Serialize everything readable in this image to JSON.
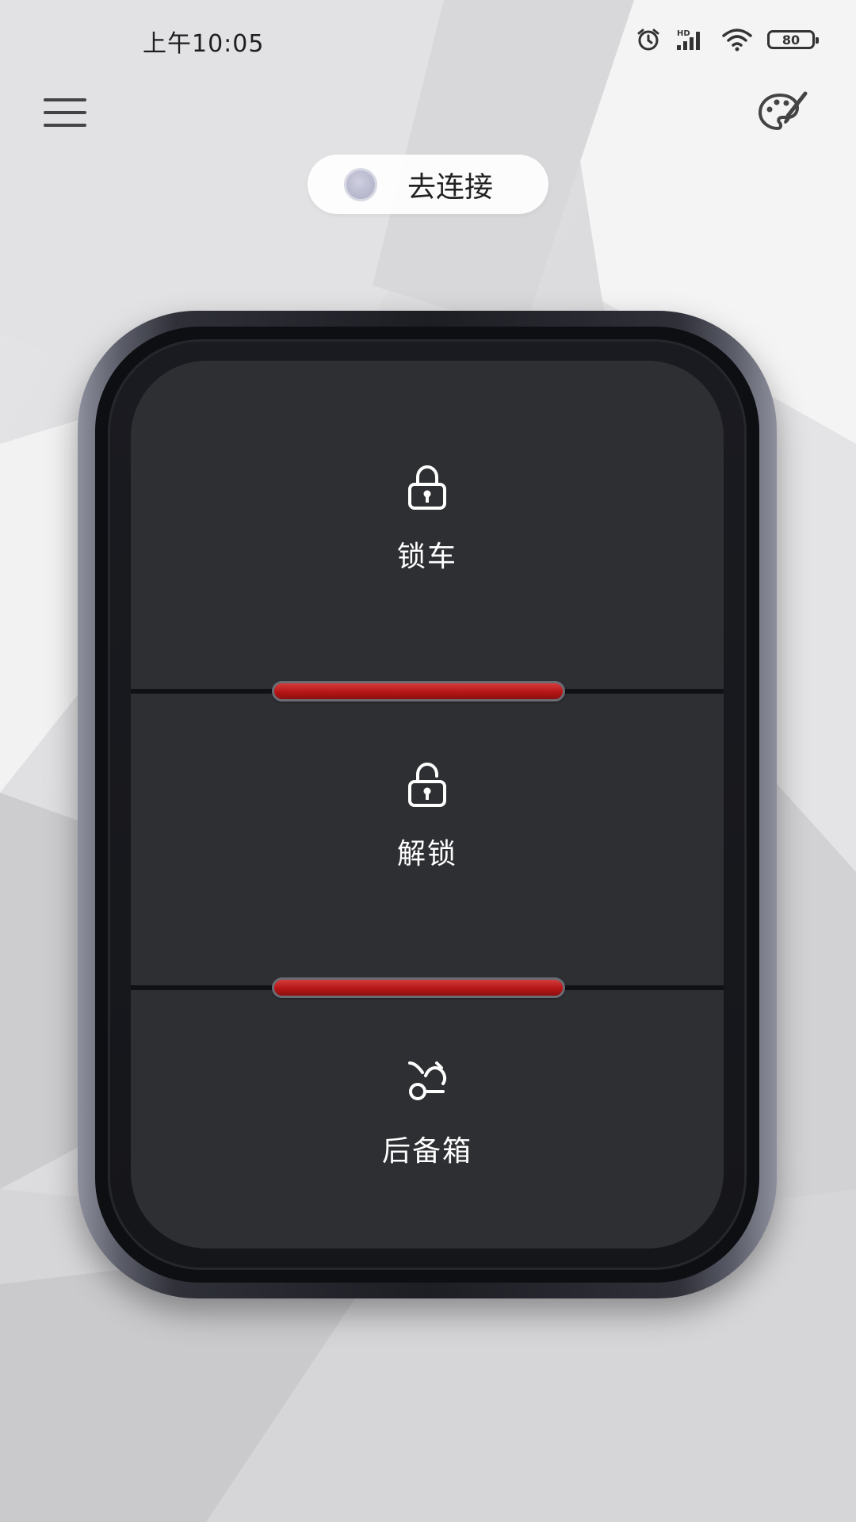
{
  "status_bar": {
    "time": "上午10:05",
    "battery": "80",
    "icons": [
      "alarm-icon",
      "hd-signal-icon",
      "wifi-icon",
      "battery-icon"
    ]
  },
  "header": {
    "menu_icon": "menu-icon",
    "theme_icon": "palette-icon"
  },
  "connect": {
    "label": "去连接",
    "state_color": "#b6b6cc"
  },
  "fob": {
    "buttons": [
      {
        "label": "锁车",
        "icon": "lock-icon"
      },
      {
        "label": "解锁",
        "icon": "unlock-icon"
      },
      {
        "label": "后备箱",
        "icon": "trunk-icon"
      }
    ],
    "accent_color": "#b51616"
  }
}
